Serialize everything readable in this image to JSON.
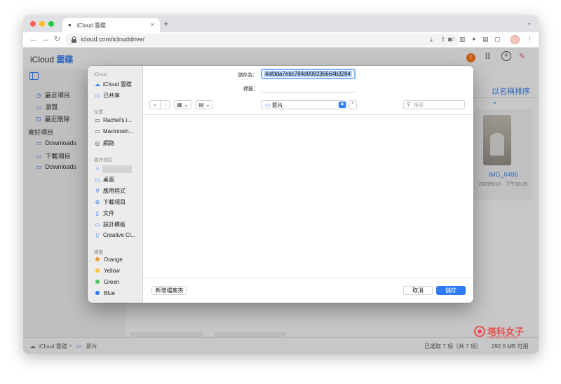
{
  "browser": {
    "tab_title": "iCloud 雲碟",
    "tab_close": "×",
    "new_tab": "+",
    "url": "icloud.com/iclouddrive/"
  },
  "icloud": {
    "logo_text": "iCloud",
    "logo_drive": "雲碟",
    "alert_badge": "!",
    "sidebar": {
      "items": [
        {
          "icon": "clock-icon",
          "glyph": "◷",
          "label": "最近項目"
        },
        {
          "icon": "folder-icon",
          "glyph": "▭",
          "label": "瀏覽"
        },
        {
          "icon": "trash-icon",
          "glyph": "⊡",
          "label": "最近刪除"
        }
      ],
      "favorites_title": "喜好項目",
      "favorites": [
        {
          "icon": "folder-icon",
          "glyph": "▭",
          "label": "Downloads"
        },
        {
          "icon": "folder-icon",
          "glyph": "▭",
          "label": "下載項目"
        },
        {
          "icon": "folder-icon",
          "glyph": "▭",
          "label": "Downloads"
        }
      ]
    },
    "sort_label": "以名稱排序 ⌄",
    "file": {
      "name": "IMG_0496",
      "date": "2023/5/10　下午10:25"
    },
    "status": {
      "root": "iCloud 雲碟",
      "separator": ">",
      "current_folder": "影片",
      "selection": "已選取 7 項（共 7 項）",
      "storage": "292.6 MB 可用"
    }
  },
  "dialog": {
    "sidebar": {
      "icloud_section": "iCloud",
      "icloud_items": [
        {
          "icon": "icloud-drive-icon",
          "glyph": "☁",
          "label": "iCloud 雲碟"
        },
        {
          "icon": "shared-folder-icon",
          "glyph": "▭",
          "label": "已共享"
        }
      ],
      "locations_section": "位置",
      "locations": [
        {
          "icon": "laptop-icon",
          "glyph": "▭",
          "label": "Rachel's i..."
        },
        {
          "icon": "disk-icon",
          "glyph": "▭",
          "label": "Macintosh..."
        },
        {
          "icon": "network-icon",
          "glyph": "◎",
          "label": "網路"
        }
      ],
      "favorites_section": "喜好項目",
      "favorites": [
        {
          "icon": "home-icon",
          "glyph": "⌂",
          "label": ""
        },
        {
          "icon": "desktop-icon",
          "glyph": "▭",
          "label": "桌面"
        },
        {
          "icon": "applications-icon",
          "glyph": "⚲",
          "label": "應用程式"
        },
        {
          "icon": "download-icon",
          "glyph": "⊕",
          "label": "下載項目"
        },
        {
          "icon": "document-icon",
          "glyph": "▯",
          "label": "文件"
        },
        {
          "icon": "folder-icon",
          "glyph": "▭",
          "label": "設計模板"
        },
        {
          "icon": "document-icon",
          "glyph": "▯",
          "label": "Creative Cl..."
        }
      ],
      "tags_section": "標籤",
      "tags": [
        {
          "label": "Orange",
          "color": "#f39a3c"
        },
        {
          "label": "Yellow",
          "color": "#f6c544"
        },
        {
          "label": "Green",
          "color": "#4cc35a"
        },
        {
          "label": "Blue",
          "color": "#2f7bf6"
        }
      ]
    },
    "save_as_label": "儲存為：",
    "save_as_value": "4afdda7ebc784d008236664b3284",
    "tags_label": "標籤：",
    "nav_back": "‹",
    "nav_forward": "›",
    "view_mode": "▦ ⌄",
    "group_mode": "▤ ⌄",
    "folder_name": "影片",
    "folder_stepper": "◆",
    "expand": "⌃",
    "search_placeholder": "搜尋",
    "new_folder_button": "新增檔案夾",
    "cancel_button": "取消",
    "save_button": "儲存"
  },
  "watermark": {
    "text": "塔科女子",
    "sub": "www.tech-girlz.com"
  },
  "colors": {
    "accent": "#2f7bf6",
    "icloud_blue": "#3b82f6",
    "alert": "#ff7a1a"
  }
}
